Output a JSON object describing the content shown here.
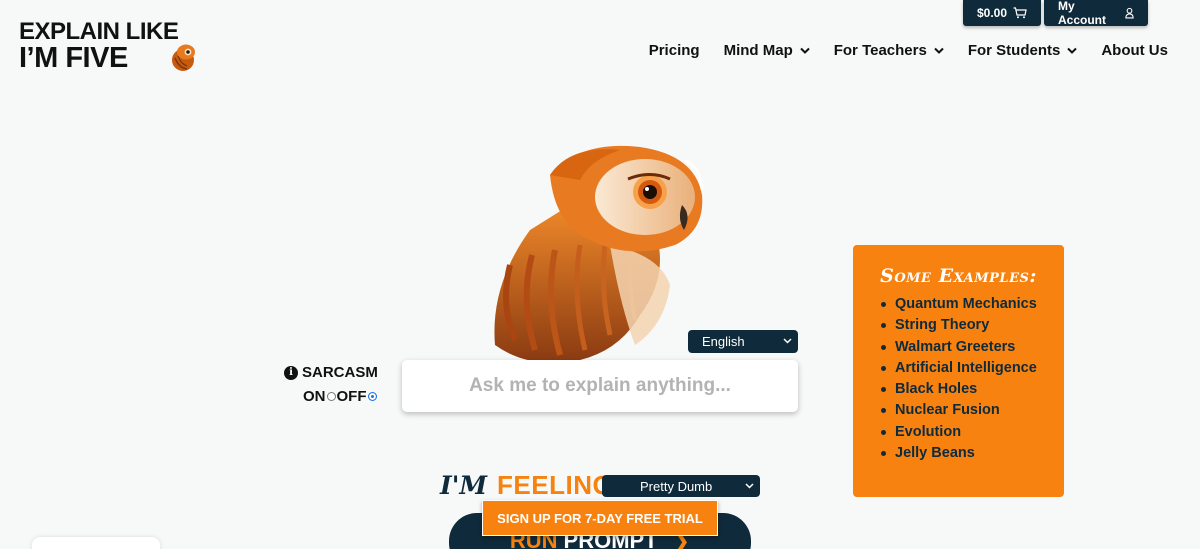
{
  "topbar": {
    "cart_label": "$0.00",
    "account_label": "My Account"
  },
  "logo": {
    "line1": "EXPLAIN LIKE",
    "line2": "I’M FIVE"
  },
  "nav": {
    "items": [
      {
        "label": "Pricing",
        "dropdown": false
      },
      {
        "label": "Mind Map",
        "dropdown": true
      },
      {
        "label": "For Teachers",
        "dropdown": true
      },
      {
        "label": "For Students",
        "dropdown": true
      },
      {
        "label": "About Us",
        "dropdown": false
      }
    ]
  },
  "language": {
    "selected": "English"
  },
  "sarcasm": {
    "label": "SARCASM",
    "on_label": "ON",
    "off_label": "OFF",
    "selected": "OFF"
  },
  "ask": {
    "placeholder": "Ask me to explain anything..."
  },
  "feeling": {
    "prefix": "I'M",
    "label": "FEELING",
    "selected": "Pretty Dumb"
  },
  "run_button": {
    "part1": "RUN",
    "part2": "PROMPT"
  },
  "signup": {
    "label": "SIGN UP FOR 7-DAY FREE TRIAL"
  },
  "examples": {
    "title": "Some Examples:",
    "items": [
      "Quantum Mechanics",
      "String Theory",
      "Walmart Greeters",
      "Artificial Intelligence",
      "Black Holes",
      "Nuclear Fusion",
      "Evolution",
      "Jelly Beans"
    ]
  },
  "colors": {
    "navy": "#0f2a3a",
    "orange": "#f7820f",
    "background": "#f7f9f9"
  }
}
